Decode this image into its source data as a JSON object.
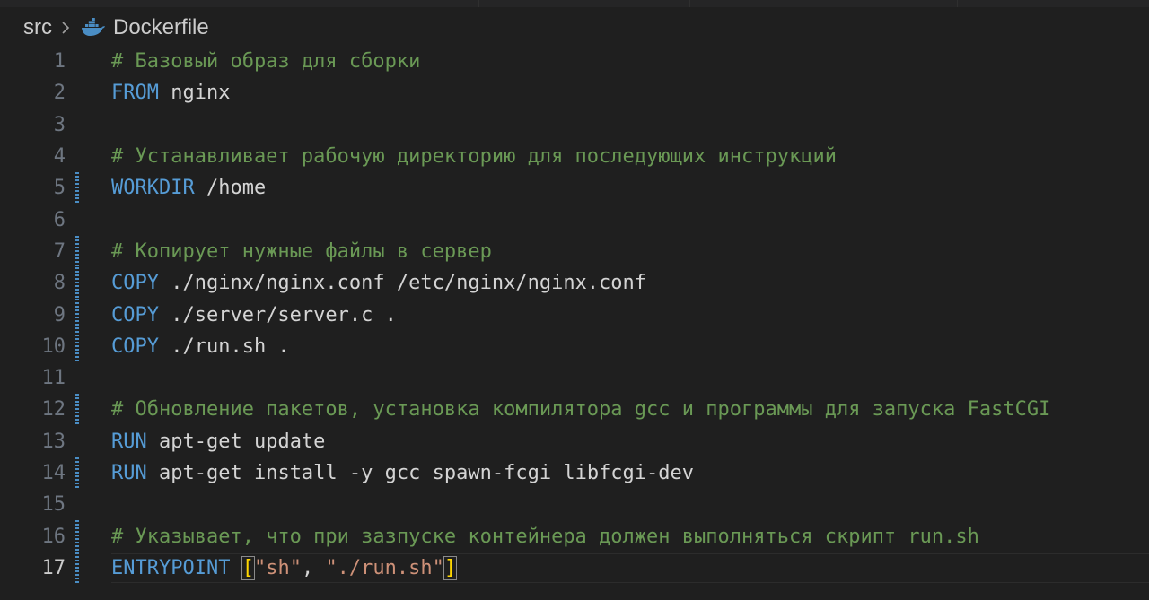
{
  "breadcrumb": {
    "folder": "src",
    "file": "Dockerfile"
  },
  "icons": {
    "file_icon": "docker-whale-icon",
    "separator_icon": "chevron-right-icon"
  },
  "colors": {
    "background": "#1f1f1f",
    "comment": "#6a9955",
    "keyword": "#569cd6",
    "text": "#d4d4d4",
    "string": "#ce9178",
    "bracket": "#ffd700",
    "line_number": "#6e7681",
    "diff_marker": "#4a8dc4"
  },
  "editor": {
    "current_line": 17,
    "lines": [
      {
        "n": "1",
        "modified": false,
        "tokens": [
          {
            "t": "# Базовый образ для сборки",
            "k": "comment"
          }
        ]
      },
      {
        "n": "2",
        "modified": false,
        "tokens": [
          {
            "t": "FROM",
            "k": "keyword"
          },
          {
            "t": " nginx",
            "k": "plain"
          }
        ]
      },
      {
        "n": "3",
        "modified": false,
        "tokens": []
      },
      {
        "n": "4",
        "modified": false,
        "tokens": [
          {
            "t": "# Устанавливает рабочую директорию для последующих инструкций",
            "k": "comment"
          }
        ]
      },
      {
        "n": "5",
        "modified": true,
        "tokens": [
          {
            "t": "WORKDIR",
            "k": "keyword"
          },
          {
            "t": " /home",
            "k": "plain"
          }
        ]
      },
      {
        "n": "6",
        "modified": false,
        "tokens": []
      },
      {
        "n": "7",
        "modified": true,
        "tokens": [
          {
            "t": "# Копирует нужные файлы в сервер",
            "k": "comment"
          }
        ]
      },
      {
        "n": "8",
        "modified": true,
        "tokens": [
          {
            "t": "COPY",
            "k": "keyword"
          },
          {
            "t": " ./nginx/nginx.conf /etc/nginx/nginx.conf",
            "k": "plain"
          }
        ]
      },
      {
        "n": "9",
        "modified": true,
        "tokens": [
          {
            "t": "COPY",
            "k": "keyword"
          },
          {
            "t": " ./server/server.c .",
            "k": "plain"
          }
        ]
      },
      {
        "n": "10",
        "modified": true,
        "tokens": [
          {
            "t": "COPY",
            "k": "keyword"
          },
          {
            "t": " ./run.sh .",
            "k": "plain"
          }
        ]
      },
      {
        "n": "11",
        "modified": false,
        "tokens": []
      },
      {
        "n": "12",
        "modified": true,
        "tokens": [
          {
            "t": "# Обновление пакетов, установка компилятора gcc и программы для запуска FastCGI",
            "k": "comment"
          }
        ]
      },
      {
        "n": "13",
        "modified": false,
        "tokens": [
          {
            "t": "RUN",
            "k": "keyword"
          },
          {
            "t": " apt-get update",
            "k": "plain"
          }
        ]
      },
      {
        "n": "14",
        "modified": true,
        "tokens": [
          {
            "t": "RUN",
            "k": "keyword"
          },
          {
            "t": " apt-get install -y gcc spawn-fcgi libfcgi-dev",
            "k": "plain"
          }
        ]
      },
      {
        "n": "15",
        "modified": false,
        "tokens": []
      },
      {
        "n": "16",
        "modified": true,
        "tokens": [
          {
            "t": "# Указывает, что при зазпуске контейнера должен выполняться скрипт run.sh",
            "k": "comment"
          }
        ]
      },
      {
        "n": "17",
        "modified": true,
        "tokens": [
          {
            "t": "ENTRYPOINT",
            "k": "keyword"
          },
          {
            "t": " ",
            "k": "plain"
          },
          {
            "t": "[",
            "k": "bracket"
          },
          {
            "t": "\"sh\"",
            "k": "string"
          },
          {
            "t": ", ",
            "k": "plain"
          },
          {
            "t": "\"./run.sh\"",
            "k": "string"
          },
          {
            "t": "]",
            "k": "bracket"
          }
        ]
      }
    ]
  }
}
